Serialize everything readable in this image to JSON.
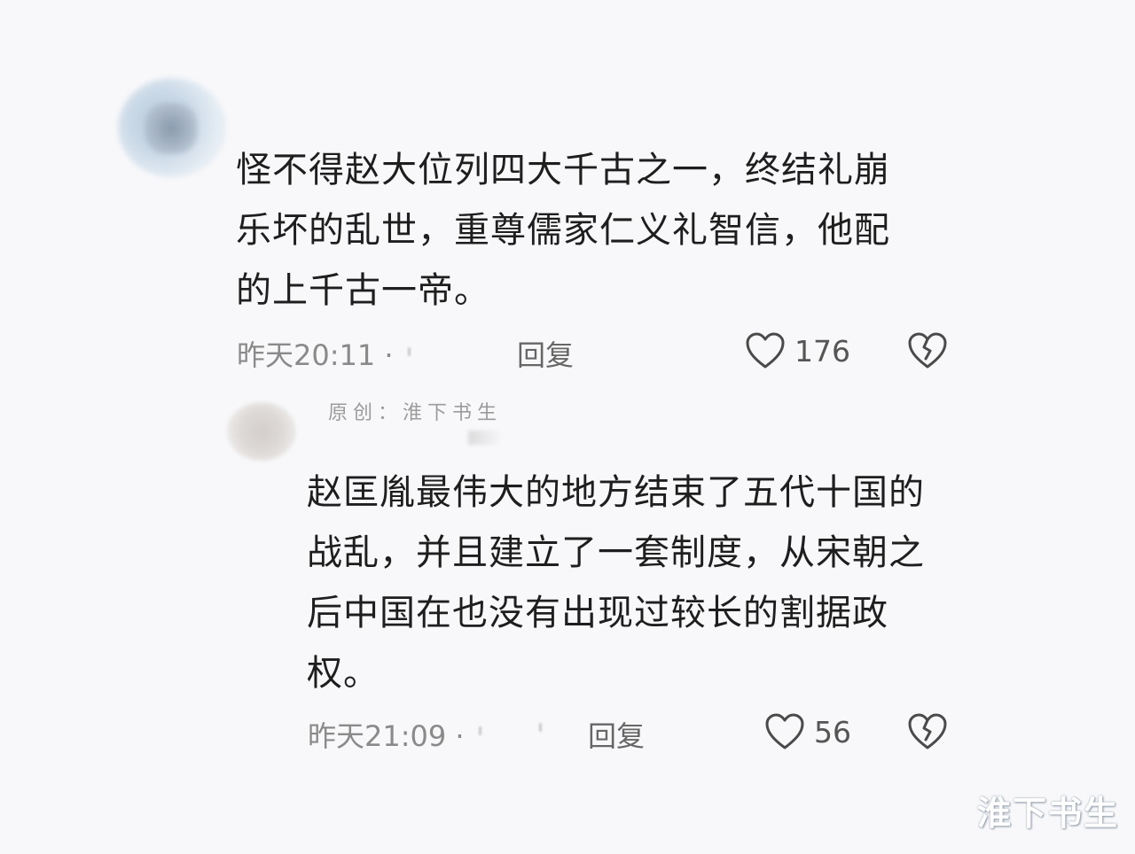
{
  "comments": [
    {
      "text": "怪不得赵大位列四大千古之一，终结礼崩\n乐坏的乱世，重尊儒家仁义礼智信，他配\n的上千古一帝。",
      "time": "昨天20:11 ·",
      "reply_label": "回复",
      "like_count": "176",
      "icons": {
        "like": "heart-outline-icon",
        "dislike": "broken-heart-icon"
      }
    },
    {
      "username_overlay": "原创：淮下书生",
      "text": "赵匡胤最伟大的地方结束了五代十国的\n战乱，并且建立了一套制度，从宋朝之\n后中国在也没有出现过较长的割据政\n权。",
      "time": "昨天21:09 ·",
      "reply_label": "回复",
      "like_count": "56",
      "icons": {
        "like": "heart-outline-icon",
        "dislike": "broken-heart-icon"
      }
    }
  ],
  "watermark": "淮下书生",
  "colors": {
    "background": "#f8f8fa",
    "text": "#1e1e1e",
    "meta": "#8a8a8a"
  }
}
